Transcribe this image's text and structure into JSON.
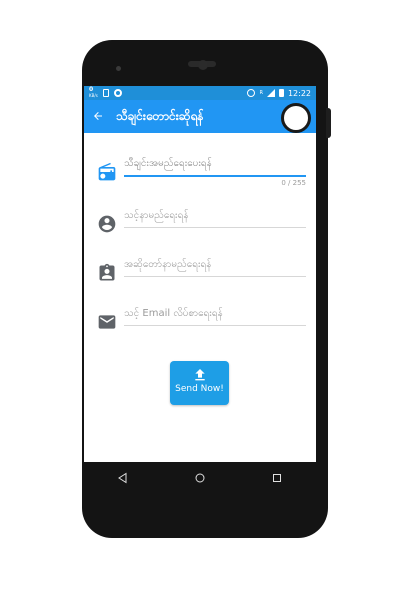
{
  "status_bar": {
    "net_speed": "0",
    "net_unit": "KB/s",
    "time": "12:22",
    "network_type": "R"
  },
  "app_bar": {
    "title": "သီချင်းတောင်းဆိုရန်",
    "back_icon": "arrow-left-icon"
  },
  "form": {
    "song_name": {
      "placeholder": "သီချင်းအမည်ရေးပေးရန်",
      "counter": "0 / 255",
      "icon": "radio-icon"
    },
    "your_name": {
      "placeholder": "သင့်နာမည်ရေးရန်",
      "icon": "account-circle-icon"
    },
    "singer_name": {
      "placeholder": "အဆိုတော်နာမည်ရေးရန်",
      "icon": "contact-card-icon"
    },
    "email": {
      "placeholder": "သင့် Email လိပ်စာရေးရန်",
      "icon": "email-icon"
    }
  },
  "send_button": {
    "label": "Send Now!",
    "icon": "upload-icon"
  },
  "colors": {
    "primary": "#2196f3",
    "status_bar": "#1f8fd8",
    "icon_gray": "#5f6368"
  }
}
